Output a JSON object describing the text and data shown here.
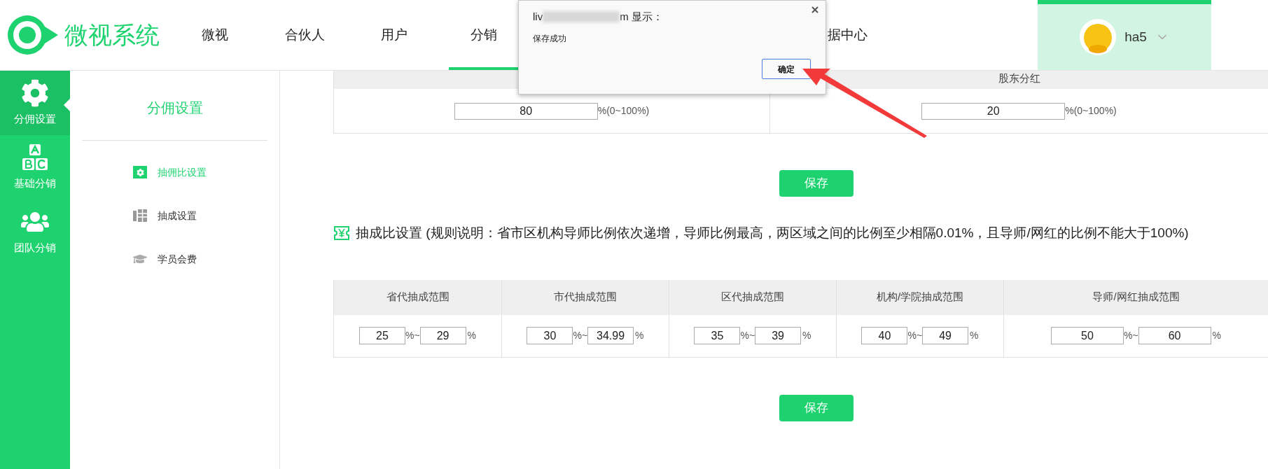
{
  "logo": {
    "text": "微视系统"
  },
  "nav": [
    {
      "label": "微视",
      "selected": false
    },
    {
      "label": "合伙人",
      "selected": false
    },
    {
      "label": "用户",
      "selected": false
    },
    {
      "label": "分销",
      "selected": true
    },
    {
      "label": "据中心",
      "selected": false
    }
  ],
  "user": {
    "name": "ha5"
  },
  "sidebar": {
    "items": [
      {
        "label": "分佣设置",
        "kind": "gear",
        "selected": true
      },
      {
        "label": "基础分销",
        "kind": "blocks",
        "selected": false
      },
      {
        "label": "团队分销",
        "kind": "team",
        "selected": false
      }
    ]
  },
  "submenu": {
    "title": "分佣设置",
    "items": [
      {
        "label": "抽佣比设置",
        "kind": "gear",
        "selected": true
      },
      {
        "label": "抽成设置",
        "kind": "grid",
        "selected": false
      },
      {
        "label": "学员会费",
        "kind": "cap",
        "selected": false
      }
    ]
  },
  "share_table": {
    "columns": [
      {
        "value": "80",
        "hint": "%(0~100%)"
      },
      {
        "header": "股东分红",
        "value": "20",
        "hint": "%(0~100%)"
      }
    ],
    "save": "保存"
  },
  "commission": {
    "title": "抽成比设置 (规则说明：省市区机构导师比例依次递增，导师比例最高，两区域之间的比例至少相隔0.01%，且导师/网红的比例不能大于100%)",
    "columns": [
      {
        "header": "省代抽成范围",
        "from": "25",
        "sep": "%~",
        "to": "29",
        "unit": "%"
      },
      {
        "header": "市代抽成范围",
        "from": "30",
        "sep": "%~",
        "to": "34.99",
        "unit": "%"
      },
      {
        "header": "区代抽成范围",
        "from": "35",
        "sep": "%~",
        "to": "39",
        "unit": "%"
      },
      {
        "header": "机构/学院抽成范围",
        "from": "40",
        "sep": "%~",
        "to": "49",
        "unit": "%"
      },
      {
        "header": "导师/网红抽成范围",
        "from": "50",
        "sep": "%~",
        "to": "60",
        "unit": "%"
      }
    ],
    "save": "保存"
  },
  "dialog": {
    "title_start": "liv",
    "title_end": "m 显示：",
    "message": "保存成功",
    "ok": "确定"
  }
}
